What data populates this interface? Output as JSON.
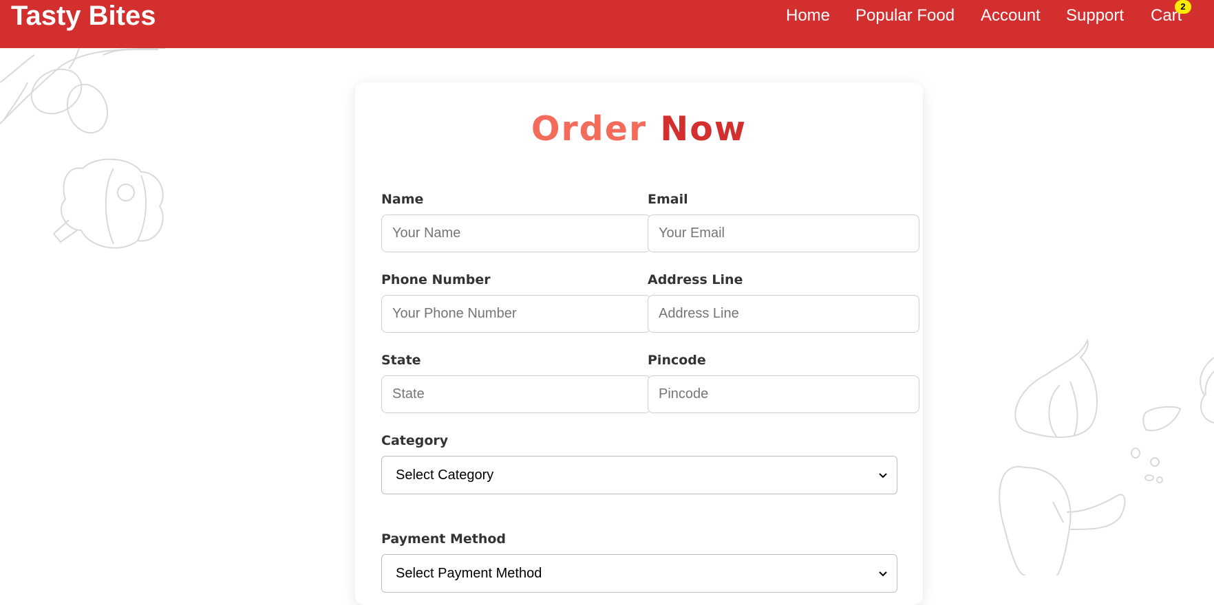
{
  "brand": "Tasty Bites",
  "nav": {
    "items": [
      "Home",
      "Popular Food",
      "Account",
      "Support",
      "Cart"
    ],
    "cart_count": "2"
  },
  "form": {
    "title_part1": "Order",
    "title_part2": "Now",
    "name": {
      "label": "Name",
      "placeholder": "Your Name",
      "value": ""
    },
    "email": {
      "label": "Email",
      "placeholder": "Your Email",
      "value": ""
    },
    "phone": {
      "label": "Phone Number",
      "placeholder": "Your Phone Number",
      "value": ""
    },
    "address": {
      "label": "Address Line",
      "placeholder": "Address Line",
      "value": ""
    },
    "state": {
      "label": "State",
      "placeholder": "State",
      "value": ""
    },
    "pincode": {
      "label": "Pincode",
      "placeholder": "Pincode",
      "value": ""
    },
    "category": {
      "label": "Category",
      "selected": "Select Category"
    },
    "payment": {
      "label": "Payment Method",
      "selected": "Select Payment Method"
    }
  },
  "colors": {
    "brand_red": "#d32f2f",
    "title_coral": "#f26b5b",
    "badge_yellow": "#ffeb00"
  },
  "icons": {
    "select_arrow": "chevron-down-icon",
    "background_decoration": "vegetable-doodle-icons"
  }
}
